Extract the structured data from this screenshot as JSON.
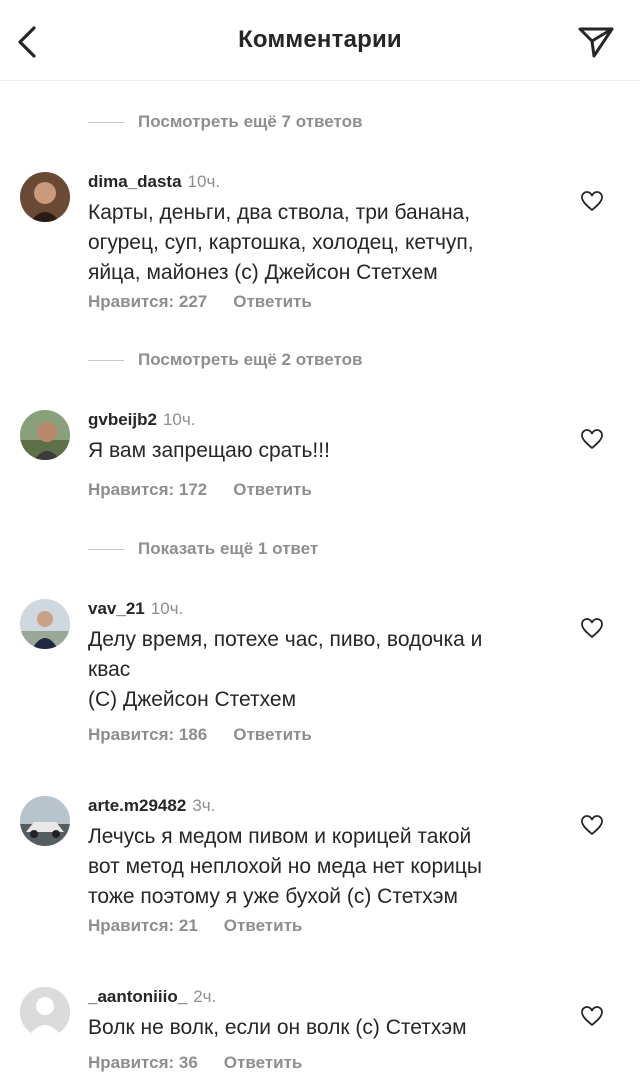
{
  "header": {
    "title": "Комментарии"
  },
  "more_replies": [
    "Посмотреть ещё 7 ответов",
    "Посмотреть ещё 2 ответов",
    "Показать ещё 1 ответ"
  ],
  "comments": [
    {
      "username": "dima_dasta",
      "time": "10ч.",
      "text": "Карты, деньги, два ствола, три банана,\nогурец, суп, картошка, холодец, кетчуп,\nяйца, майонез (с) Джейсон Стетхем",
      "likes": "Нравится: 227",
      "reply": "Ответить"
    },
    {
      "username": "gvbeijb2",
      "time": "10ч.",
      "text": "Я вам запрещаю срать!!!",
      "likes": "Нравится: 172",
      "reply": "Ответить"
    },
    {
      "username": "vav_21",
      "time": "10ч.",
      "text": "Делу время, потехе час, пиво, водочка и\nквас\n(С) Джейсон Стетхем",
      "likes": "Нравится: 186",
      "reply": "Ответить"
    },
    {
      "username": "arte.m29482",
      "time": "3ч.",
      "text": "Лечусь я медом пивом и корицей такой\nвот метод неплохой но меда нет корицы\nтоже поэтому я уже бухой (с) Стетхэм",
      "likes": "Нравится: 21",
      "reply": "Ответить"
    },
    {
      "username": "_aantoniiio_",
      "time": "2ч.",
      "text": "Волк не волк, если он волк (с) Стетхэм",
      "likes": "Нравится: 36",
      "reply": "Ответить"
    }
  ]
}
